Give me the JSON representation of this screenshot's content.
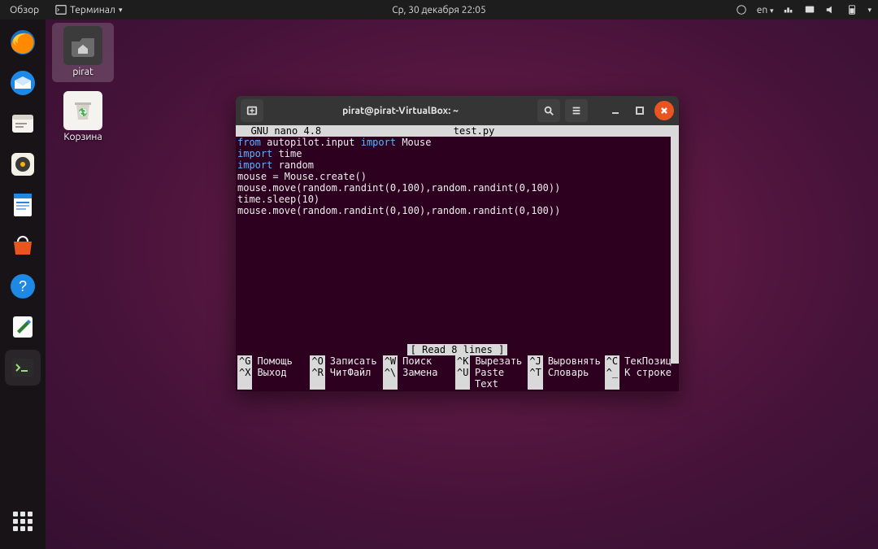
{
  "topbar": {
    "activities": "Обзор",
    "app_menu": "Терминал",
    "clock": "Ср, 30 декабря  22:05",
    "lang": "en"
  },
  "desktop": {
    "home": {
      "label": "pirat"
    },
    "trash": {
      "label": "Корзина"
    }
  },
  "terminal": {
    "title": "pirat@pirat-VirtualBox: ~",
    "nano": {
      "app": "GNU nano 4.8",
      "filename": "test.py",
      "status": "[ Read 8 lines ]",
      "code": {
        "l1a": "from",
        "l1b": " autopilot.input ",
        "l1c": "import",
        "l1d": " Mouse",
        "l2a": "import",
        "l2b": " time",
        "l3a": "import",
        "l3b": " random",
        "l4": "mouse = Mouse.create()",
        "l5": "mouse.move(random.randint(0,100),random.randint(0,100))",
        "l6": "time.sleep(10)",
        "l7": "mouse.move(random.randint(0,100),random.randint(0,100))"
      },
      "keys": {
        "g": "^G",
        "x": "^X",
        "o": "^O",
        "r": "^R",
        "w": "^W",
        "bs": "^\\",
        "k": "^K",
        "u": "^U",
        "j": "^J",
        "t": "^T",
        "c": "^C",
        "ul": "^_"
      },
      "labels": {
        "help": "Помощь",
        "exit": "Выход",
        "write": "Записать",
        "read": "ЧитФайл",
        "search": "Поиск",
        "replace": "Замена",
        "cut": "Вырезать",
        "paste": "Paste Text",
        "justify": "Выровнять",
        "spell": "Словарь",
        "curpos": "ТекПозиц",
        "goto": "К строке"
      }
    }
  }
}
